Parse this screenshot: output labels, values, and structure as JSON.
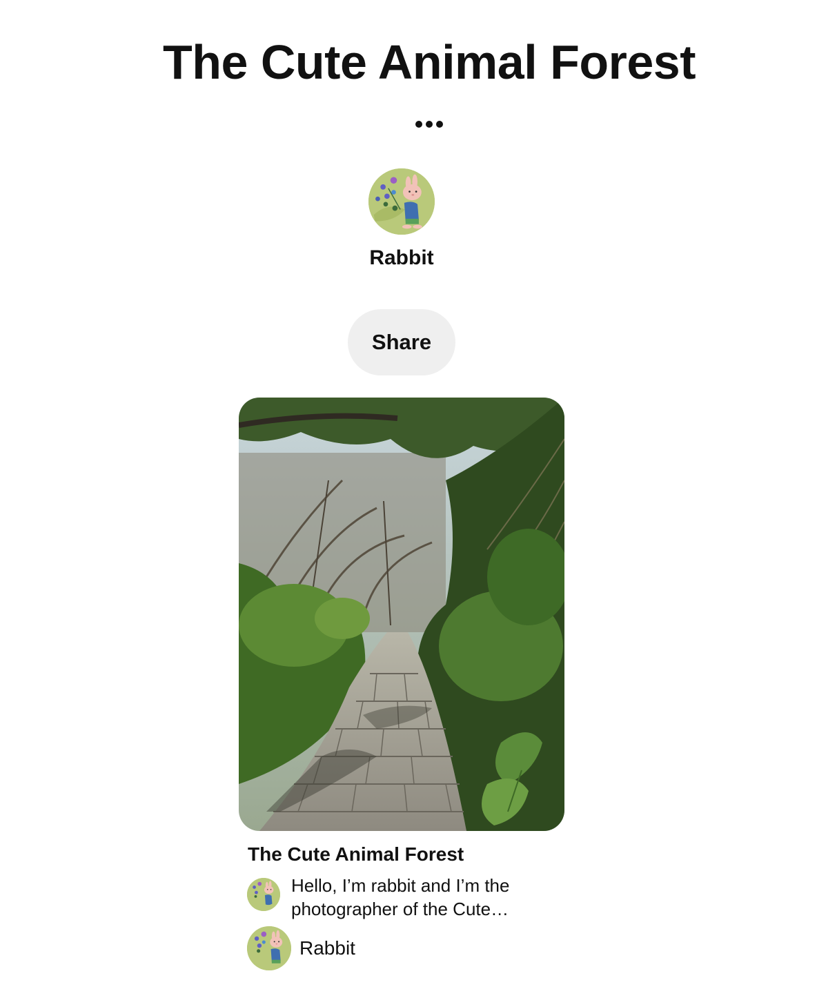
{
  "board": {
    "title": "The Cute Animal Forest",
    "more_icon": "ellipsis-icon"
  },
  "owner": {
    "name": "Rabbit",
    "avatar_icon": "rabbit-avatar-icon"
  },
  "actions": {
    "share_label": "Share"
  },
  "pin": {
    "image_description_icon": "forest-path-photo",
    "title": "The Cute Animal Forest",
    "description": "Hello, I’m rabbit and I’m the photographer of the Cute…",
    "author_name": "Rabbit"
  },
  "colors": {
    "text": "#111111",
    "share_button_bg": "#efefef",
    "avatar_bg": "#b9c97a"
  }
}
